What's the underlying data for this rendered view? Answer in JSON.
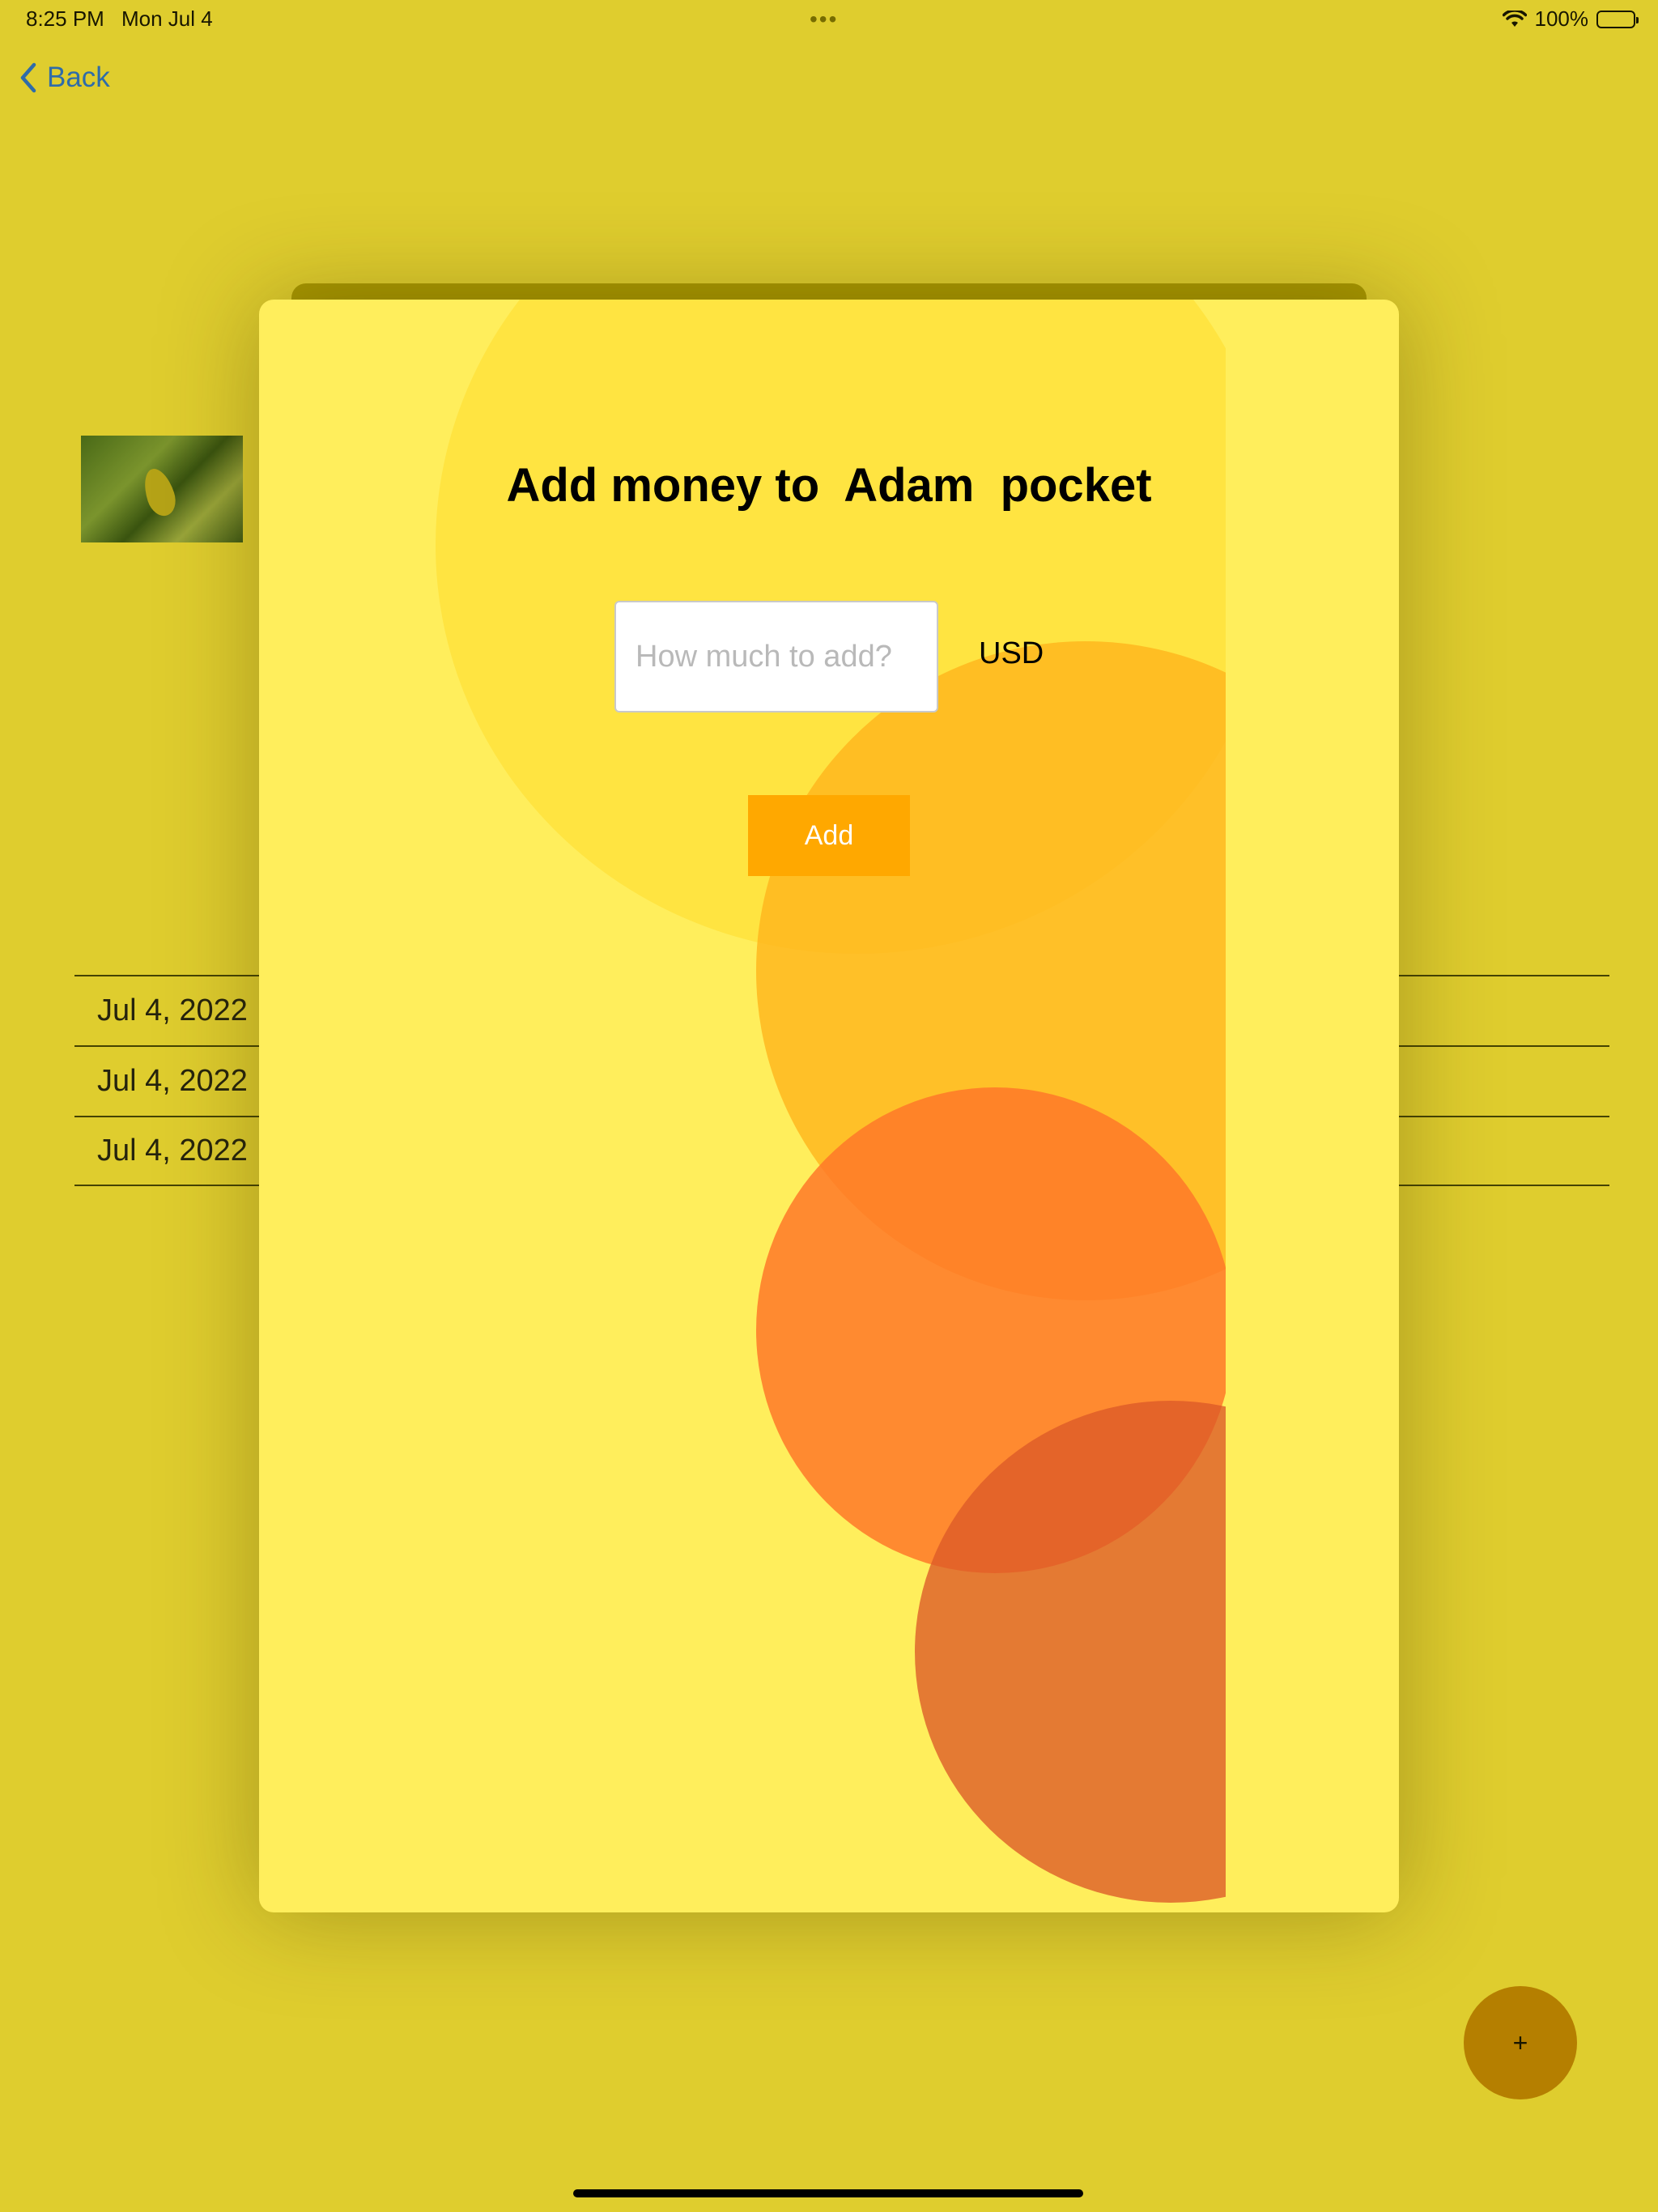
{
  "status_bar": {
    "time": "8:25 PM",
    "date": "Mon Jul 4",
    "battery": "100%",
    "icons": [
      "wifi-icon",
      "battery-icon",
      "more-dots-icon"
    ]
  },
  "nav": {
    "back_label": "Back",
    "back_icon": "chevron-left-icon"
  },
  "transactions": [
    {
      "date": "Jul 4, 2022"
    },
    {
      "date": "Jul 4, 2022"
    },
    {
      "date": "Jul 4, 2022"
    }
  ],
  "fab": {
    "label": "+"
  },
  "modal": {
    "title": "Add money to  Adam  pocket",
    "amount_placeholder": "How much to add?",
    "amount_value": "",
    "currency": "USD",
    "add_label": "Add"
  },
  "colors": {
    "background": "#ffeb3b",
    "accent_button": "#ffa800",
    "fab": "#c98700",
    "link": "#1e6fd9"
  }
}
